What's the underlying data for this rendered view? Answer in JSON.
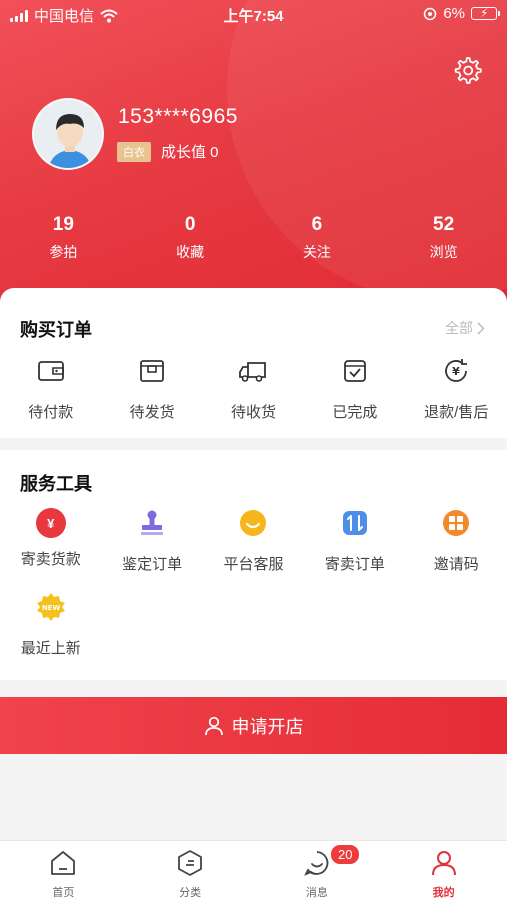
{
  "status_bar": {
    "carrier": "中国电信",
    "time": "上午7:54",
    "battery": "6%"
  },
  "profile": {
    "phone": "153****6965",
    "level": "白衣",
    "growth": "成长值 0"
  },
  "stats": [
    {
      "value": "19",
      "label": "参拍"
    },
    {
      "value": "0",
      "label": "收藏"
    },
    {
      "value": "6",
      "label": "关注"
    },
    {
      "value": "52",
      "label": "浏览"
    }
  ],
  "orders": {
    "title": "购买订单",
    "view_all": "全部",
    "items": [
      {
        "label": "待付款",
        "icon": "wallet-icon"
      },
      {
        "label": "待发货",
        "icon": "box-icon"
      },
      {
        "label": "待收货",
        "icon": "truck-icon"
      },
      {
        "label": "已完成",
        "icon": "completed-icon"
      },
      {
        "label": "退款/售后",
        "icon": "refund-icon"
      }
    ]
  },
  "tools": {
    "title": "服务工具",
    "items": [
      {
        "label": "寄卖货款",
        "icon": "yen-icon",
        "color": "#e8373f"
      },
      {
        "label": "鉴定订单",
        "icon": "stamp-icon",
        "color": "#7d6ce0"
      },
      {
        "label": "平台客服",
        "icon": "service-icon",
        "color": "#f6b51b"
      },
      {
        "label": "寄卖订单",
        "icon": "transfer-icon",
        "color": "#4d8ee8"
      },
      {
        "label": "邀请码",
        "icon": "grid-icon",
        "color": "#f08a2c"
      },
      {
        "label": "最近上新",
        "icon": "new-icon",
        "color": "#f4c21c",
        "badge_text": "NEW"
      }
    ]
  },
  "open_store": {
    "label": "申请开店"
  },
  "tabbar": {
    "items": [
      {
        "label": "首页"
      },
      {
        "label": "分类"
      },
      {
        "label": "消息"
      },
      {
        "label": "我的"
      }
    ],
    "message_badge": "20"
  }
}
